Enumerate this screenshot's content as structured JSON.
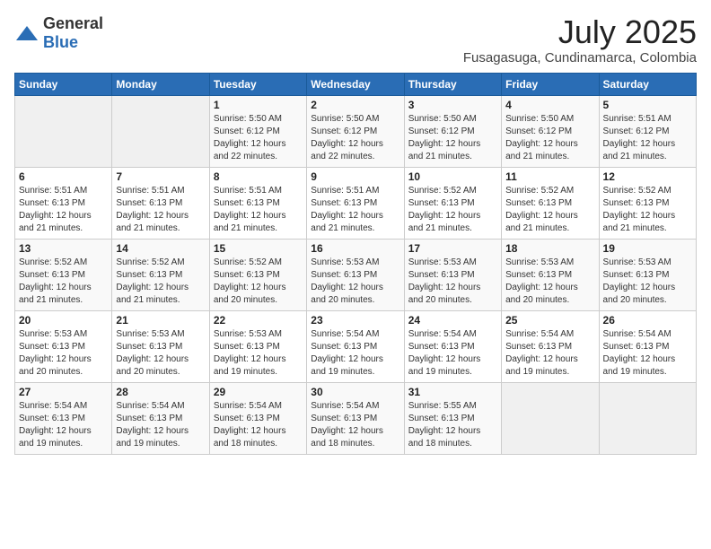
{
  "logo": {
    "general": "General",
    "blue": "Blue"
  },
  "header": {
    "title": "July 2025",
    "subtitle": "Fusagasuga, Cundinamarca, Colombia"
  },
  "weekdays": [
    "Sunday",
    "Monday",
    "Tuesday",
    "Wednesday",
    "Thursday",
    "Friday",
    "Saturday"
  ],
  "weeks": [
    [
      {
        "day": "",
        "empty": true
      },
      {
        "day": "",
        "empty": true
      },
      {
        "day": "1",
        "sunrise": "Sunrise: 5:50 AM",
        "sunset": "Sunset: 6:12 PM",
        "daylight": "Daylight: 12 hours and 22 minutes."
      },
      {
        "day": "2",
        "sunrise": "Sunrise: 5:50 AM",
        "sunset": "Sunset: 6:12 PM",
        "daylight": "Daylight: 12 hours and 22 minutes."
      },
      {
        "day": "3",
        "sunrise": "Sunrise: 5:50 AM",
        "sunset": "Sunset: 6:12 PM",
        "daylight": "Daylight: 12 hours and 21 minutes."
      },
      {
        "day": "4",
        "sunrise": "Sunrise: 5:50 AM",
        "sunset": "Sunset: 6:12 PM",
        "daylight": "Daylight: 12 hours and 21 minutes."
      },
      {
        "day": "5",
        "sunrise": "Sunrise: 5:51 AM",
        "sunset": "Sunset: 6:12 PM",
        "daylight": "Daylight: 12 hours and 21 minutes."
      }
    ],
    [
      {
        "day": "6",
        "sunrise": "Sunrise: 5:51 AM",
        "sunset": "Sunset: 6:13 PM",
        "daylight": "Daylight: 12 hours and 21 minutes."
      },
      {
        "day": "7",
        "sunrise": "Sunrise: 5:51 AM",
        "sunset": "Sunset: 6:13 PM",
        "daylight": "Daylight: 12 hours and 21 minutes."
      },
      {
        "day": "8",
        "sunrise": "Sunrise: 5:51 AM",
        "sunset": "Sunset: 6:13 PM",
        "daylight": "Daylight: 12 hours and 21 minutes."
      },
      {
        "day": "9",
        "sunrise": "Sunrise: 5:51 AM",
        "sunset": "Sunset: 6:13 PM",
        "daylight": "Daylight: 12 hours and 21 minutes."
      },
      {
        "day": "10",
        "sunrise": "Sunrise: 5:52 AM",
        "sunset": "Sunset: 6:13 PM",
        "daylight": "Daylight: 12 hours and 21 minutes."
      },
      {
        "day": "11",
        "sunrise": "Sunrise: 5:52 AM",
        "sunset": "Sunset: 6:13 PM",
        "daylight": "Daylight: 12 hours and 21 minutes."
      },
      {
        "day": "12",
        "sunrise": "Sunrise: 5:52 AM",
        "sunset": "Sunset: 6:13 PM",
        "daylight": "Daylight: 12 hours and 21 minutes."
      }
    ],
    [
      {
        "day": "13",
        "sunrise": "Sunrise: 5:52 AM",
        "sunset": "Sunset: 6:13 PM",
        "daylight": "Daylight: 12 hours and 21 minutes."
      },
      {
        "day": "14",
        "sunrise": "Sunrise: 5:52 AM",
        "sunset": "Sunset: 6:13 PM",
        "daylight": "Daylight: 12 hours and 21 minutes."
      },
      {
        "day": "15",
        "sunrise": "Sunrise: 5:52 AM",
        "sunset": "Sunset: 6:13 PM",
        "daylight": "Daylight: 12 hours and 20 minutes."
      },
      {
        "day": "16",
        "sunrise": "Sunrise: 5:53 AM",
        "sunset": "Sunset: 6:13 PM",
        "daylight": "Daylight: 12 hours and 20 minutes."
      },
      {
        "day": "17",
        "sunrise": "Sunrise: 5:53 AM",
        "sunset": "Sunset: 6:13 PM",
        "daylight": "Daylight: 12 hours and 20 minutes."
      },
      {
        "day": "18",
        "sunrise": "Sunrise: 5:53 AM",
        "sunset": "Sunset: 6:13 PM",
        "daylight": "Daylight: 12 hours and 20 minutes."
      },
      {
        "day": "19",
        "sunrise": "Sunrise: 5:53 AM",
        "sunset": "Sunset: 6:13 PM",
        "daylight": "Daylight: 12 hours and 20 minutes."
      }
    ],
    [
      {
        "day": "20",
        "sunrise": "Sunrise: 5:53 AM",
        "sunset": "Sunset: 6:13 PM",
        "daylight": "Daylight: 12 hours and 20 minutes."
      },
      {
        "day": "21",
        "sunrise": "Sunrise: 5:53 AM",
        "sunset": "Sunset: 6:13 PM",
        "daylight": "Daylight: 12 hours and 20 minutes."
      },
      {
        "day": "22",
        "sunrise": "Sunrise: 5:53 AM",
        "sunset": "Sunset: 6:13 PM",
        "daylight": "Daylight: 12 hours and 19 minutes."
      },
      {
        "day": "23",
        "sunrise": "Sunrise: 5:54 AM",
        "sunset": "Sunset: 6:13 PM",
        "daylight": "Daylight: 12 hours and 19 minutes."
      },
      {
        "day": "24",
        "sunrise": "Sunrise: 5:54 AM",
        "sunset": "Sunset: 6:13 PM",
        "daylight": "Daylight: 12 hours and 19 minutes."
      },
      {
        "day": "25",
        "sunrise": "Sunrise: 5:54 AM",
        "sunset": "Sunset: 6:13 PM",
        "daylight": "Daylight: 12 hours and 19 minutes."
      },
      {
        "day": "26",
        "sunrise": "Sunrise: 5:54 AM",
        "sunset": "Sunset: 6:13 PM",
        "daylight": "Daylight: 12 hours and 19 minutes."
      }
    ],
    [
      {
        "day": "27",
        "sunrise": "Sunrise: 5:54 AM",
        "sunset": "Sunset: 6:13 PM",
        "daylight": "Daylight: 12 hours and 19 minutes."
      },
      {
        "day": "28",
        "sunrise": "Sunrise: 5:54 AM",
        "sunset": "Sunset: 6:13 PM",
        "daylight": "Daylight: 12 hours and 19 minutes."
      },
      {
        "day": "29",
        "sunrise": "Sunrise: 5:54 AM",
        "sunset": "Sunset: 6:13 PM",
        "daylight": "Daylight: 12 hours and 18 minutes."
      },
      {
        "day": "30",
        "sunrise": "Sunrise: 5:54 AM",
        "sunset": "Sunset: 6:13 PM",
        "daylight": "Daylight: 12 hours and 18 minutes."
      },
      {
        "day": "31",
        "sunrise": "Sunrise: 5:55 AM",
        "sunset": "Sunset: 6:13 PM",
        "daylight": "Daylight: 12 hours and 18 minutes."
      },
      {
        "day": "",
        "empty": true
      },
      {
        "day": "",
        "empty": true
      }
    ]
  ]
}
